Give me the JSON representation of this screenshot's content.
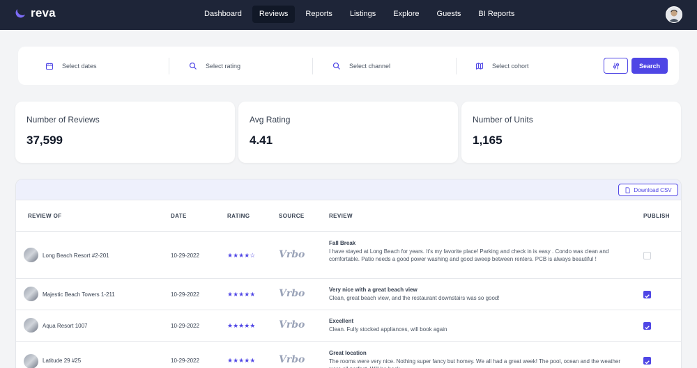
{
  "brand": {
    "name": "reva"
  },
  "nav": {
    "items": [
      {
        "label": "Dashboard",
        "active": false
      },
      {
        "label": "Reviews",
        "active": true
      },
      {
        "label": "Reports",
        "active": false
      },
      {
        "label": "Listings",
        "active": false
      },
      {
        "label": "Explore",
        "active": false
      },
      {
        "label": "Guests",
        "active": false
      },
      {
        "label": "BI Reports",
        "active": false
      }
    ]
  },
  "filters": {
    "dates": "Select dates",
    "rating": "Select rating",
    "channel": "Select channel",
    "cohort": "Select cohort",
    "search_label": "Search"
  },
  "stats": [
    {
      "label": "Number of Reviews",
      "value": "37,599"
    },
    {
      "label": "Avg Rating",
      "value": "4.41"
    },
    {
      "label": "Number of Units",
      "value": "1,165"
    }
  ],
  "table": {
    "download_label": "Download CSV",
    "headers": {
      "review_of": "REVIEW OF",
      "date": "DATE",
      "rating": "RATING",
      "source": "SOURCE",
      "review": "REVIEW",
      "publish": "PUBLISH"
    },
    "rows": [
      {
        "listing": "Long Beach Resort #2-201",
        "date": "10-29-2022",
        "rating": 4,
        "source": "Vrbo",
        "title": "Fall Break",
        "body": "I have stayed at Long Beach for years. It’s my favorite place! Parking and check in is easy . Condo was clean and comfortable. Patio needs a good power washing and good sweep between renters. PCB is always beautiful !",
        "published": false
      },
      {
        "listing": "Majestic Beach Towers 1-211",
        "date": "10-29-2022",
        "rating": 5,
        "source": "Vrbo",
        "title": "Very nice with a great beach view",
        "body": "Clean, great beach view, and the restaurant downstairs was so good!",
        "published": true
      },
      {
        "listing": "Aqua Resort 1007",
        "date": "10-29-2022",
        "rating": 5,
        "source": "Vrbo",
        "title": "Excellent",
        "body": "Clean. Fully stocked appliances, will book again",
        "published": true
      },
      {
        "listing": "Latitude 29 #25",
        "date": "10-29-2022",
        "rating": 5,
        "source": "Vrbo",
        "title": "Great location",
        "body": "The rooms were very nice. Nothing super fancy but homey. We all had a great week! The pool, ocean and the weather were all perfect. Will be back",
        "published": true
      }
    ]
  },
  "colors": {
    "nav_bg": "#1e2538",
    "accent": "#4f46e5",
    "page_bg": "#f3f4f6"
  }
}
